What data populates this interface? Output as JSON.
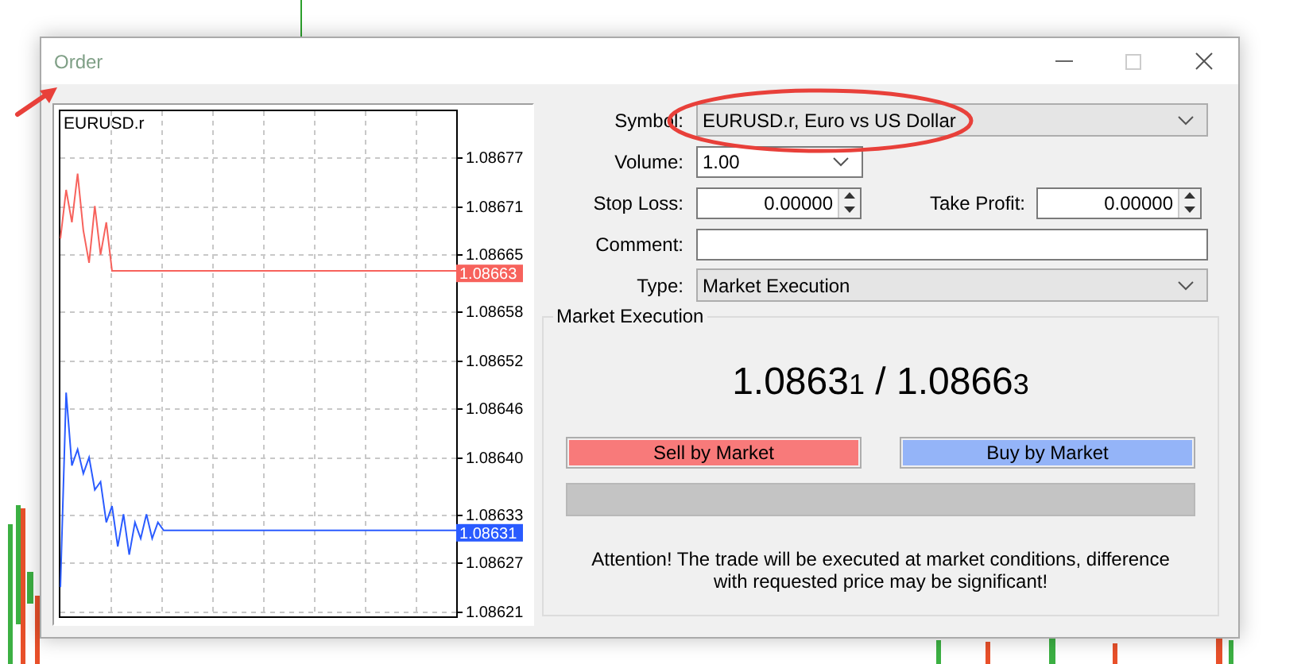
{
  "window": {
    "title": "Order"
  },
  "chart": {
    "symbol": "EURUSD.r",
    "chart_data": {
      "type": "line",
      "grid": true,
      "categories": [
        null,
        null,
        null,
        null,
        null,
        null,
        null,
        null,
        null,
        null,
        null,
        null,
        null,
        null,
        null,
        null,
        null,
        null,
        null,
        null,
        null,
        null,
        null,
        null,
        null,
        null,
        null,
        null,
        null,
        null,
        null,
        null,
        null,
        null,
        null,
        null,
        null,
        null,
        null,
        null,
        null,
        null,
        null,
        null,
        null,
        null,
        null,
        null,
        null,
        null,
        null,
        null,
        null,
        null,
        null,
        null,
        null,
        null,
        null,
        null,
        null,
        null,
        null,
        null,
        null,
        null,
        null,
        null,
        null,
        null
      ],
      "ylim": [
        1.086204,
        1.086827
      ],
      "yticks": [
        {
          "value": 1.08677,
          "label": "1.08677"
        },
        {
          "value": 1.08671,
          "label": "1.08671"
        },
        {
          "value": 1.08665,
          "label": "1.08665"
        },
        {
          "value": 1.08658,
          "label": "1.08658"
        },
        {
          "value": 1.08652,
          "label": "1.08652"
        },
        {
          "value": 1.08646,
          "label": "1.08646"
        },
        {
          "value": 1.0864,
          "label": "1.08640"
        },
        {
          "value": 1.08633,
          "label": "1.08633"
        },
        {
          "value": 1.08627,
          "label": "1.08627"
        },
        {
          "value": 1.08621,
          "label": "1.08621"
        }
      ],
      "series": [
        {
          "color": "#f7625c",
          "values": [
            1.08667,
            1.08673,
            1.08669,
            1.08675,
            1.08668,
            1.08664,
            1.08671,
            1.08665,
            1.08669,
            1.08663,
            1.08663,
            1.08663,
            1.08663,
            1.08663,
            1.08663,
            1.08663,
            1.08663,
            1.08663,
            1.08663,
            1.08663,
            1.08663,
            1.08663,
            1.08663,
            1.08663,
            1.08663,
            1.08663,
            1.08663,
            1.08663,
            1.08663,
            1.08663,
            1.08663,
            1.08663,
            1.08663,
            1.08663,
            1.08663,
            1.08663,
            1.08663,
            1.08663,
            1.08663,
            1.08663,
            1.08663,
            1.08663,
            1.08663,
            1.08663,
            1.08663,
            1.08663,
            1.08663,
            1.08663,
            1.08663,
            1.08663,
            1.08663,
            1.08663,
            1.08663,
            1.08663,
            1.08663,
            1.08663,
            1.08663,
            1.08663,
            1.08663,
            1.08663,
            1.08663,
            1.08663,
            1.08663,
            1.08663,
            1.08663,
            1.08663,
            1.08663,
            1.08663,
            1.08663,
            1.08663
          ]
        },
        {
          "color": "#2a5bff",
          "values": [
            1.08624,
            1.08648,
            1.08639,
            1.08641,
            1.08638,
            1.0864,
            1.08636,
            1.08637,
            1.08632,
            1.08634,
            1.08629,
            1.08633,
            1.08628,
            1.08632,
            1.0863,
            1.08633,
            1.0863,
            1.08632,
            1.08631,
            1.08631,
            1.08631,
            1.08631,
            1.08631,
            1.08631,
            1.08631,
            1.08631,
            1.08631,
            1.08631,
            1.08631,
            1.08631,
            1.08631,
            1.08631,
            1.08631,
            1.08631,
            1.08631,
            1.08631,
            1.08631,
            1.08631,
            1.08631,
            1.08631,
            1.08631,
            1.08631,
            1.08631,
            1.08631,
            1.08631,
            1.08631,
            1.08631,
            1.08631,
            1.08631,
            1.08631,
            1.08631,
            1.08631,
            1.08631,
            1.08631,
            1.08631,
            1.08631,
            1.08631,
            1.08631,
            1.08631,
            1.08631,
            1.08631,
            1.08631,
            1.08631,
            1.08631,
            1.08631,
            1.08631,
            1.08631,
            1.08631,
            1.08631,
            1.08631
          ]
        }
      ]
    },
    "price_tags": [
      {
        "text": "1.08663",
        "color": "#f7625c"
      },
      {
        "text": "1.08631",
        "color": "#2a5bff"
      }
    ]
  },
  "form": {
    "rows": [
      {
        "fields": [
          {
            "label": "Symbol:",
            "kind": "select",
            "value": "EURUSD.r, Euro vs US Dollar"
          }
        ]
      },
      {
        "fields": [
          {
            "label": "Volume:",
            "kind": "combo",
            "value": "1.00"
          }
        ]
      },
      {
        "fields": [
          {
            "label": "Stop Loss:",
            "kind": "spin",
            "value": "0.00000"
          },
          {
            "label": "Take Profit:",
            "kind": "spin",
            "value": "0.00000"
          }
        ]
      },
      {
        "fields": [
          {
            "label": "Comment:",
            "kind": "text"
          }
        ]
      },
      {
        "fields": [
          {
            "label": "Type:",
            "kind": "select",
            "value": "Market Execution"
          }
        ]
      }
    ]
  },
  "execution": {
    "title": "Market Execution",
    "quote": "1.0863$_{1}$ / 1.0866$_{3}$",
    "buttons": [
      {
        "label": "Sell by Market",
        "kind": "sell"
      },
      {
        "label": "Buy by Market",
        "kind": "buy"
      }
    ],
    "progress": {
      "level": 0
    },
    "notice": "Attention! The trade will be executed at market conditions, difference with requested price may be significant!"
  },
  "annotations": {
    "title_arrow": true,
    "symbol_ellipse": true
  }
}
